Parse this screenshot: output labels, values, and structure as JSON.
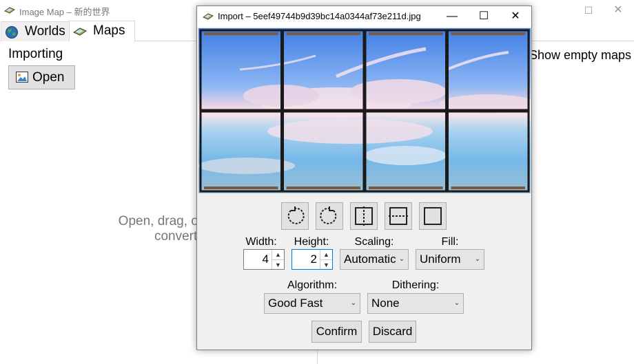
{
  "main_window": {
    "title": "Image Map – 新的世界",
    "controls": {
      "minimize": "—",
      "maximize": "☐",
      "close": "✕"
    },
    "tabs": [
      {
        "label": "Worlds",
        "icon": "globe-icon",
        "active": false
      },
      {
        "label": "Maps",
        "icon": "map-icon",
        "active": true
      }
    ],
    "importing_label": "Importing",
    "open_button": "Open",
    "hint_line1": "Open, drag, or paste images h",
    "hint_line2": "convert them to m",
    "show_empty_maps": "Show empty maps"
  },
  "dialog": {
    "title": "Import – 5eef49744b9d39bc14a0344af73e211d.jpg",
    "controls": {
      "minimize": "—",
      "maximize": "☐",
      "close": "✕"
    },
    "preview": {
      "columns": 4,
      "rows": 2
    },
    "tools": [
      "rotate-left-icon",
      "rotate-right-icon",
      "flip-horizontal-icon",
      "flip-vertical-icon",
      "frame-icon"
    ],
    "width_label": "Width:",
    "width_value": "4",
    "height_label": "Height:",
    "height_value": "2",
    "scaling_label": "Scaling:",
    "scaling_value": "Automatic",
    "fill_label": "Fill:",
    "fill_value": "Uniform",
    "algorithm_label": "Algorithm:",
    "algorithm_value": "Good Fast",
    "dithering_label": "Dithering:",
    "dithering_value": "None",
    "confirm_button": "Confirm",
    "discard_button": "Discard"
  }
}
